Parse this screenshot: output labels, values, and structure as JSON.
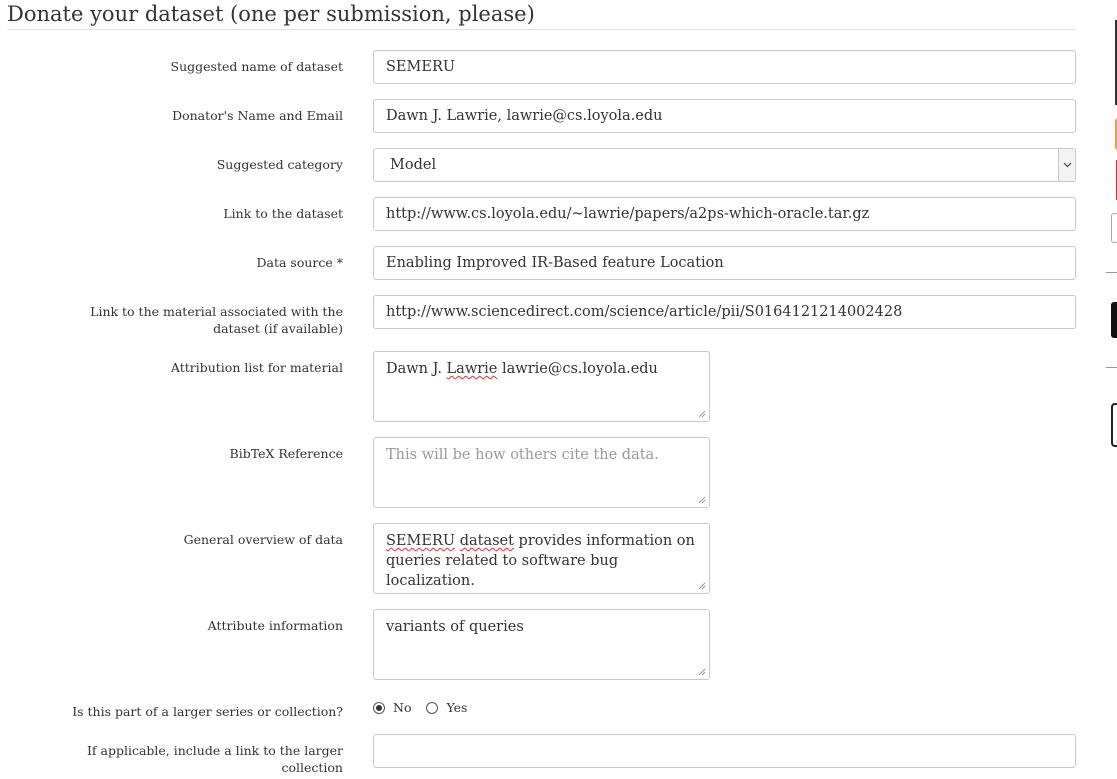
{
  "page": {
    "title": "Donate your dataset (one per submission, please)"
  },
  "form": {
    "dataset_name": {
      "label": "Suggested name of dataset",
      "value": "SEMERU"
    },
    "donator": {
      "label": "Donator's Name and Email",
      "value": "Dawn J. Lawrie, lawrie@cs.loyola.edu"
    },
    "category": {
      "label": "Suggested category",
      "value": "Model"
    },
    "dataset_link": {
      "label": "Link to the dataset",
      "value": "http://www.cs.loyola.edu/~lawrie/papers/a2ps-which-oracle.tar.gz"
    },
    "data_source": {
      "label": "Data source *",
      "value": "Enabling Improved IR-Based feature Location"
    },
    "material_link": {
      "label": "Link to the material associated with the dataset (if available)",
      "value": "http://www.sciencedirect.com/science/article/pii/S0164121214002428"
    },
    "attribution": {
      "label": "Attribution list for material",
      "value_pre": "Dawn J. ",
      "value_misspelled": "Lawrie",
      "value_post": " lawrie@cs.loyola.edu"
    },
    "bibtex": {
      "label": "BibTeX Reference",
      "placeholder": "This will be how others cite the data."
    },
    "overview": {
      "label": "General overview of data",
      "value_misspelled_1": "SEMERU",
      "value_space": " ",
      "value_misspelled_2": "dataset",
      "value_post": " provides information on queries related to software bug localization."
    },
    "attribute_info": {
      "label": "Attribute information",
      "value": "variants of queries"
    },
    "series": {
      "label": "Is this part of a larger series or collection?",
      "option_no": "No",
      "option_yes": "Yes",
      "selected": "No"
    },
    "collection_link": {
      "label": "If applicable, include a link to the larger collection",
      "value": ""
    }
  }
}
